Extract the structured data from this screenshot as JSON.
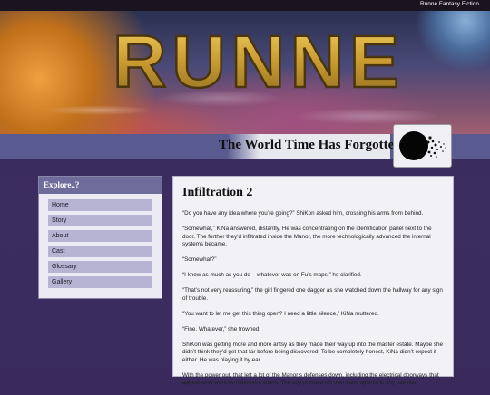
{
  "site_name": "Runne Fantasy Fiction",
  "banner": {
    "logo_text": "RUNNE"
  },
  "tagline": "The World Time Has Forgotten",
  "sidebar": {
    "title": "Explore..?",
    "items": [
      {
        "label": "Home"
      },
      {
        "label": "Story"
      },
      {
        "label": "About"
      },
      {
        "label": "Cast"
      },
      {
        "label": "Glossary"
      },
      {
        "label": "Gallery"
      }
    ]
  },
  "article": {
    "title": "Infiltration 2",
    "paragraphs": [
      "“Do you have any idea where you’re going?” ShiKon asked him, crossing his arms from behind.",
      "“Somewhat,” KiNa answered, distantly. He was concentrating on the identification panel next to the door. The further they’d infiltrated inside the Manor, the more technologically advanced the internal systems became.",
      "“Somewhat?”",
      "“I know as much as you do – whatever was on Fu’s maps,” he clarified.",
      "“That’s not very reassuring,” the girl fingered one dagger as she watched down the hallway for any sign of trouble.",
      "“You want to let me get this thing open? I need a little silence,” KiNa muttered.",
      "“Fine. Whatever,” she frowned.",
      "ShiKon was getting more and more antsy as they made their way up into the master estate. Maybe she didn’t think they’d get that far before being discovered. To be completely honest, KiNa didn’t expect it either. He was playing it by ear.",
      "With the power out, that left a lot of the Manor’s defenses down, including the electrical doorways that appeared to work by hand print scans. The boy pressed his own palm against it, tiny hair like"
    ]
  }
}
